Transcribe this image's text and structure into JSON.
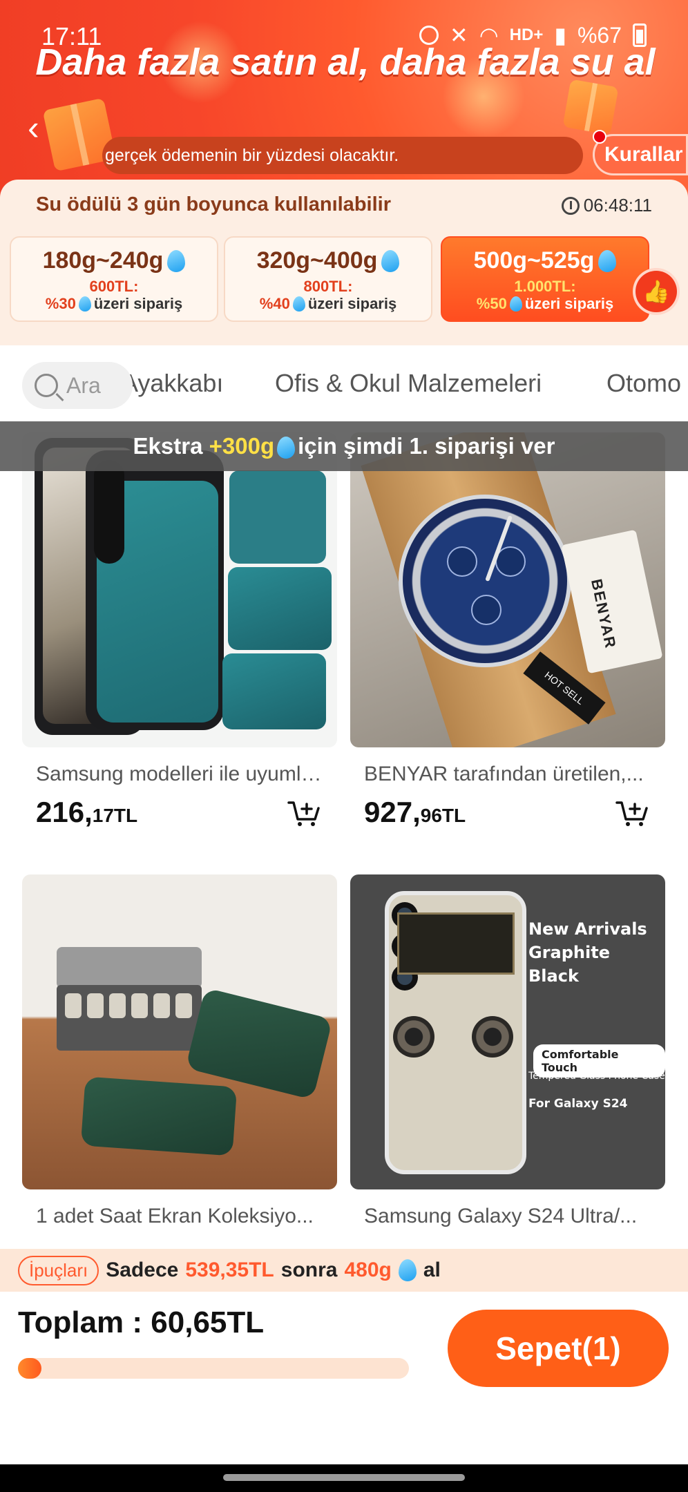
{
  "status_bar": {
    "time": "17:11",
    "network": "HD+",
    "battery": "%67"
  },
  "header": {
    "title": "Daha fazla satın al, daha fazla su al",
    "marquee": "gerçek ödemenin bir yüzdesi olacaktır.",
    "rules_button": "Kurallar"
  },
  "reward": {
    "title": "Su ödülü 3 gün boyunca kullanılabilir",
    "countdown": "06:48:11",
    "tiers": [
      {
        "water": "180g~240g",
        "price": "600TL:",
        "percent": "%30",
        "cond": "üzeri sipariş",
        "active": false
      },
      {
        "water": "320g~400g",
        "price": "800TL:",
        "percent": "%40",
        "cond": "üzeri sipariş",
        "active": false
      },
      {
        "water": "500g~525g",
        "price": "1.000TL:",
        "percent": "%50",
        "cond": "üzeri sipariş",
        "active": true
      }
    ]
  },
  "tabs": {
    "search_placeholder": "Ara",
    "items": [
      "Ayakkabı",
      "Ofis & Okul Malzemeleri",
      "Otomo"
    ]
  },
  "promo": {
    "prefix": "Ekstra",
    "amount": "+300g",
    "suffix": "için şimdi 1. siparişi ver"
  },
  "products": [
    {
      "title": "Samsung modelleri ile uyumlu...",
      "price_int": "216,",
      "price_dec": "17TL"
    },
    {
      "title": "BENYAR tarafından üretilen,...",
      "price_int": "927,",
      "price_dec": "96TL",
      "image_text": [
        "BENYAR",
        "HOT SELL"
      ]
    },
    {
      "title": "1 adet Saat Ekran Koleksiyo...",
      "price_int": "",
      "price_dec": ""
    },
    {
      "title": "Samsung Galaxy S24 Ultra/...",
      "price_int": "",
      "price_dec": "",
      "image_text": [
        "New Arrivals",
        "Graphite Black",
        "Comfortable Touch",
        "Tempered Glass Phone Case",
        "For Galaxy S24"
      ]
    }
  ],
  "tips": {
    "label": "İpuçları",
    "prefix": "Sadece",
    "amount": "539,35TL",
    "middle": "sonra",
    "water": "480g",
    "suffix": "al"
  },
  "bottom": {
    "total": "Toplam : 60,65TL",
    "progress": 0.04,
    "cart_button": "Sepet(1)"
  },
  "colors": {
    "accent": "#ff5f17",
    "header": "#f7462a",
    "water": "#1ea0f0"
  }
}
